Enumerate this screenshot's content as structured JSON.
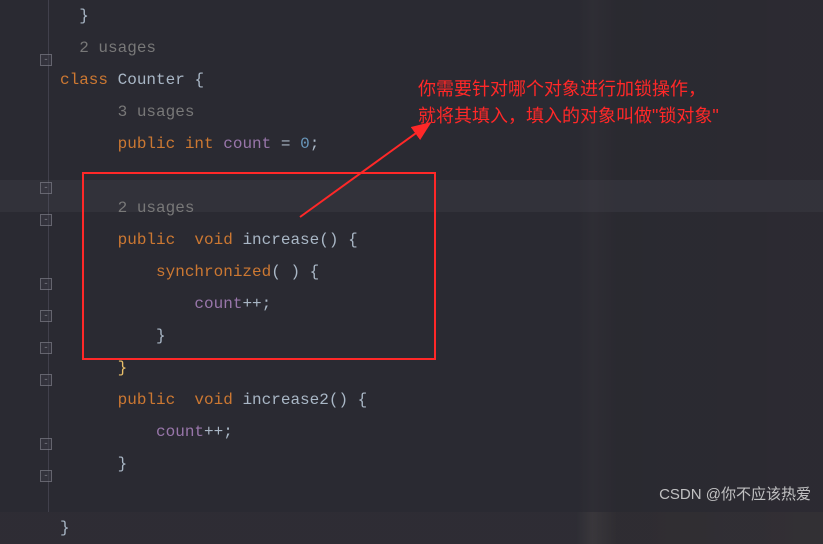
{
  "usages": {
    "classUsages": "2 usages",
    "fieldUsages": "3 usages",
    "methodUsages": "2 usages"
  },
  "code": {
    "classKw": "class",
    "className": "Counter",
    "publicKw": "public",
    "intType": "int",
    "voidType": "void",
    "countField": "count",
    "eq": " = ",
    "zero": "0",
    "semi": ";",
    "increase": "increase",
    "increase2": "increase2",
    "syncKw": "synchronized",
    "countInc": "count",
    "inc": "++",
    "openBrace": "{",
    "closeBrace": "}",
    "parens": "()",
    "openParen": "(",
    "closeParen": ")"
  },
  "annotation": {
    "line1": "你需要针对哪个对象进行加锁操作，",
    "line2": "就将其填入，填入的对象叫做\"锁对象\""
  },
  "watermark": "CSDN @你不应该热爱"
}
